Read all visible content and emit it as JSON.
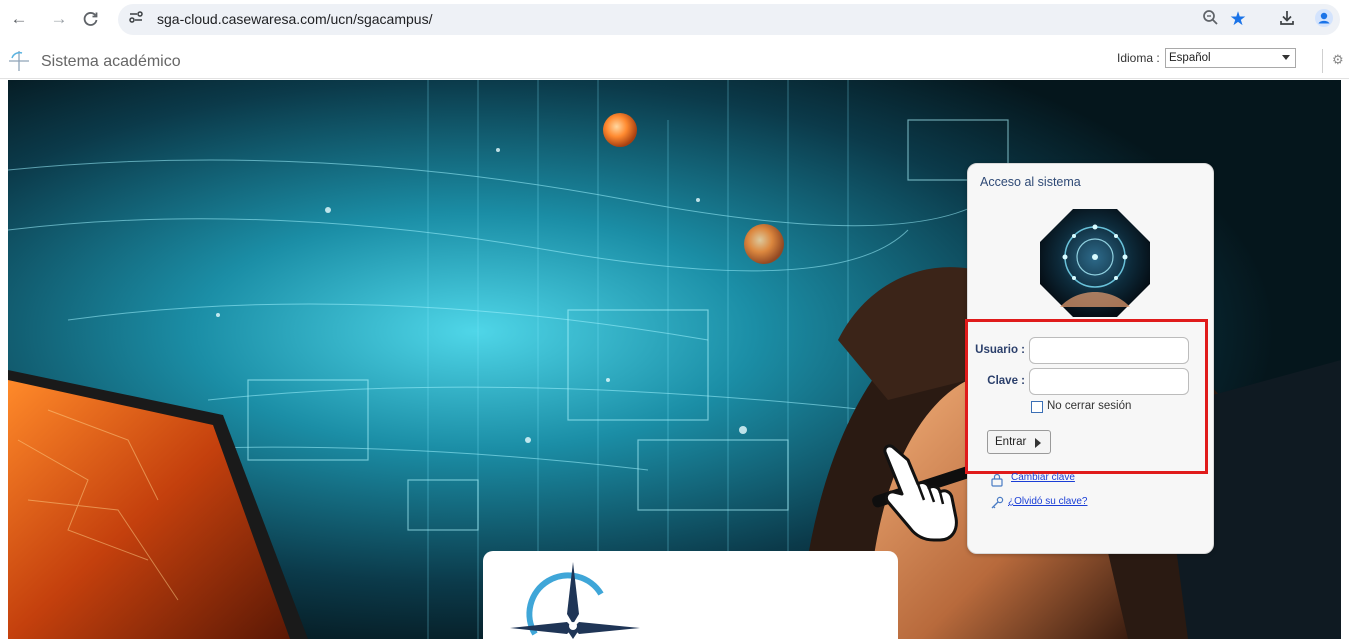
{
  "browser": {
    "url": "sga-cloud.casewaresa.com/ucn/sgacampus/",
    "nav_icons": [
      "back-arrow-icon",
      "forward-arrow-icon",
      "reload-icon",
      "site-info-icon"
    ],
    "toolbar_icons": [
      "zoom-icon",
      "bookmark-star-icon",
      "download-icon",
      "profile-icon"
    ],
    "accent_color": "#1a73e8"
  },
  "header": {
    "app_title": "Sistema académico",
    "language_label": "Idioma :",
    "language_selected": "Español"
  },
  "login": {
    "title": "Acceso al sistema",
    "username_label": "Usuario :",
    "username_value": "",
    "password_label": "Clave :",
    "password_value": "",
    "remember_label": "No cerrar sesión",
    "remember_checked": false,
    "submit_label": "Entrar",
    "change_password_link": "Cambiar clave",
    "forgot_password_link": "¿Olvidó su clave?",
    "highlight_color": "#e01b1b"
  }
}
